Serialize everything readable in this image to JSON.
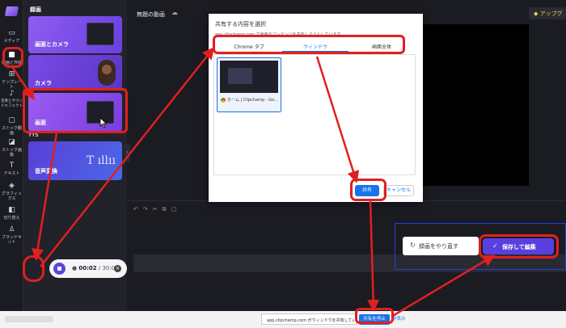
{
  "app": {
    "project_title": "無題の動画",
    "export_label": "アップグ"
  },
  "rail": [
    {
      "label": "メディア",
      "icon": "folder-icon"
    },
    {
      "label": "録画と作成",
      "icon": "record-icon"
    },
    {
      "label": "テンプレート",
      "icon": "template-icon"
    },
    {
      "label": "音楽とサウンドエフェクト",
      "icon": "music-icon"
    },
    {
      "label": "ストック動画",
      "icon": "film-icon"
    },
    {
      "label": "ストック画像",
      "icon": "image-icon"
    },
    {
      "label": "テキスト",
      "icon": "text-icon"
    },
    {
      "label": "グラフィックス",
      "icon": "shapes-icon"
    },
    {
      "label": "切り替え",
      "icon": "transition-icon"
    },
    {
      "label": "ブランドキット",
      "icon": "brand-icon"
    }
  ],
  "panel": {
    "title": "録画",
    "cards": [
      {
        "label": "画面とカメラ"
      },
      {
        "label": "カメラ"
      },
      {
        "label": "画面"
      },
      {
        "label": "音声変換"
      }
    ],
    "tts_section": "TTS"
  },
  "recorder": {
    "elapsed": "00:02",
    "limit": "/ 30:00"
  },
  "dialog": {
    "title": "共有する内容を選択",
    "subtitle": "app.clipchamp.com で画面のコンテンツを共有しようとしています",
    "tabs": [
      "Chrome タブ",
      "ウィンドウ",
      "画面全体"
    ],
    "active_tab": 1,
    "window_name": "ホーム | Clipchamp - Go...",
    "share_label": "共有",
    "cancel_label": "キャンセル"
  },
  "capture": {
    "redo_label": "録画をやり直す",
    "save_label": "保存して編集"
  },
  "share_bar": {
    "notice": "app.clipchamp.com がウィンドウを共有しています。",
    "stop_label": "共有を停止",
    "hide_label": "非表示"
  },
  "colors": {
    "accent": "#5a3fe0",
    "chrome_blue": "#1a73e8",
    "annotation_red": "#e02020"
  }
}
